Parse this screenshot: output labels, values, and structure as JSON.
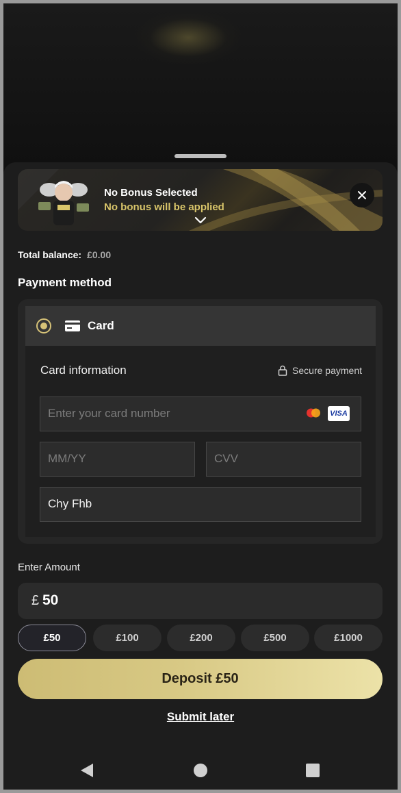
{
  "bonus": {
    "title": "No Bonus Selected",
    "subtitle": "No bonus will be applied",
    "avatar_icon": "mascot-avatar-icon",
    "chevron_icon": "chevron-down-icon",
    "close_icon": "close-icon",
    "accent_color": "#d9c56a"
  },
  "balance": {
    "label": "Total balance:",
    "value": "£0.00"
  },
  "payment": {
    "title": "Payment method",
    "method_label": "Card",
    "method_selected": true,
    "card_info_title": "Card information",
    "secure_label": "Secure payment",
    "card_number_placeholder": "Enter your card number",
    "expiry_placeholder": "MM/YY",
    "cvv_placeholder": "CVV",
    "cardholder_name": "Chy Fhb",
    "brands": [
      "mastercard-icon",
      "VISA"
    ]
  },
  "amount": {
    "label": "Enter Amount",
    "currency": "£",
    "value": "50",
    "presets": [
      "£50",
      "£100",
      "£200",
      "£500",
      "£1000"
    ],
    "selected_preset": "£50"
  },
  "actions": {
    "deposit_label": "Deposit £50",
    "submit_later_label": "Submit later",
    "deposit_color": "#d8c985"
  },
  "navigation": {
    "icons": [
      "back-icon",
      "home-icon",
      "recent-apps-icon"
    ]
  }
}
